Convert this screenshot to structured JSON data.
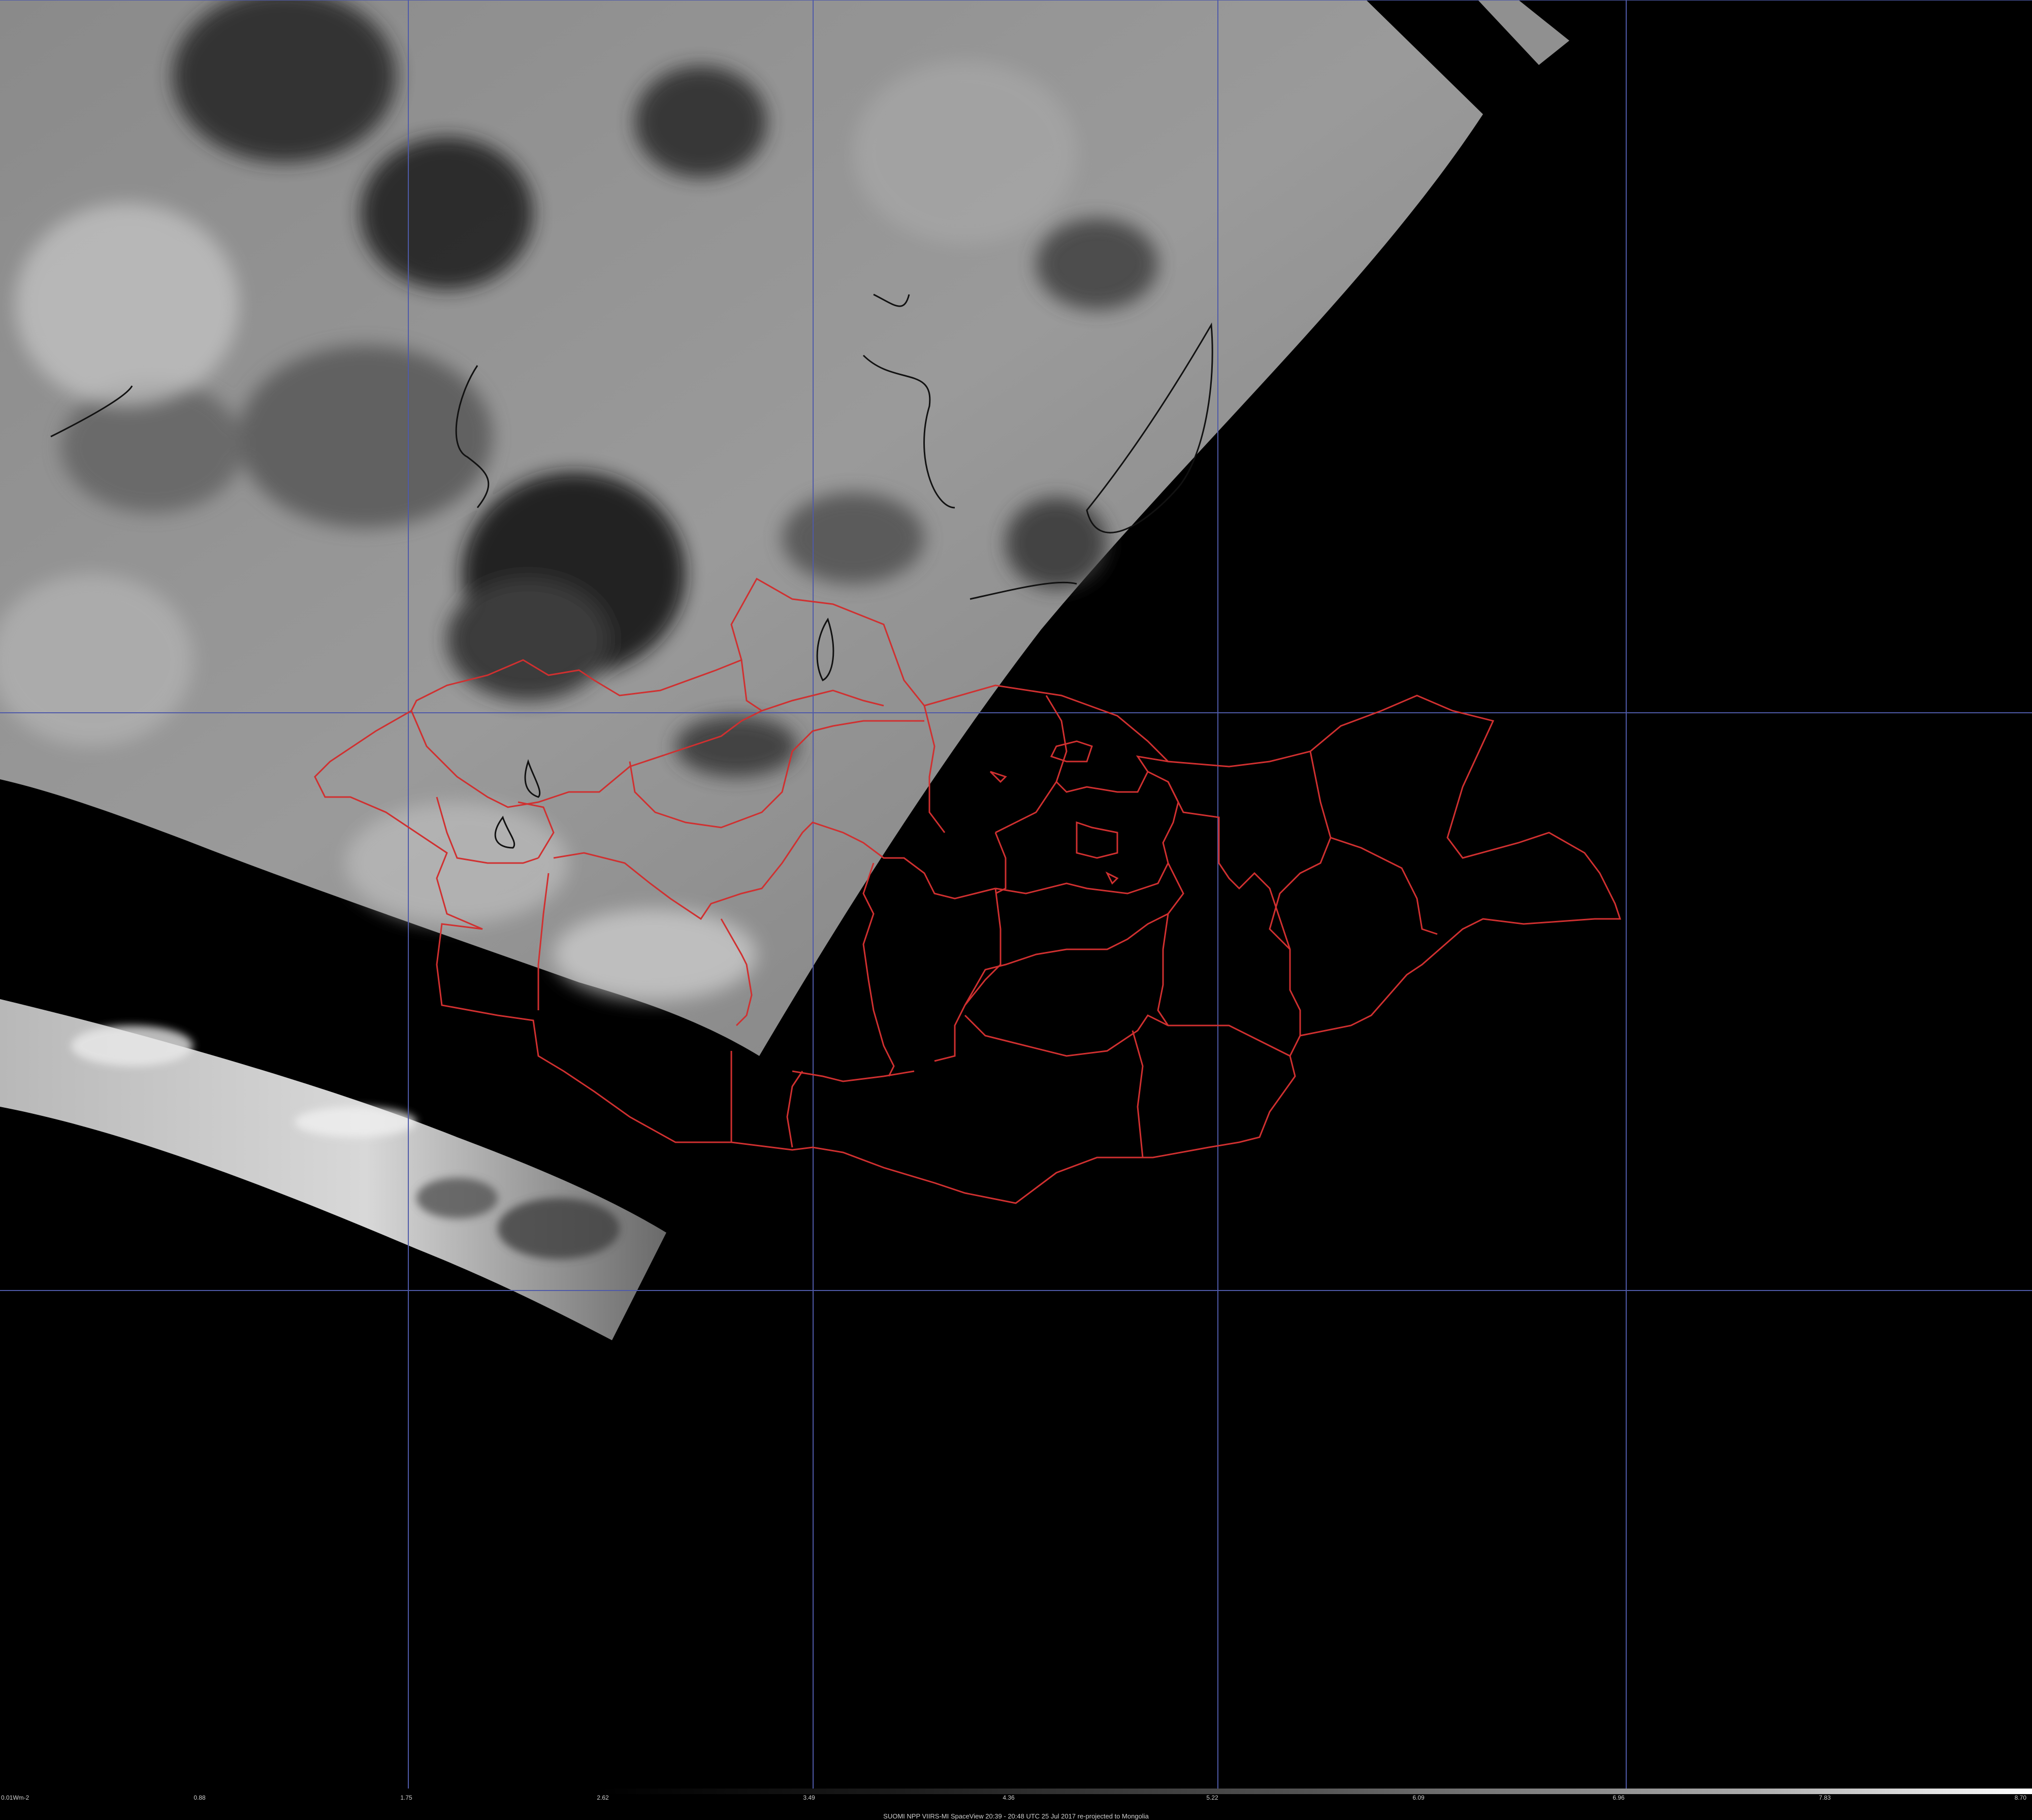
{
  "map": {
    "background": "#000000",
    "graticule_color": "#4f5aa8",
    "border_color": "#d03030",
    "water_outline_color": "#111111",
    "imagery": "grayscale satellite swaths (clouds dark, surface light)"
  },
  "colorbar": {
    "tick_labels": [
      "0.01Wm-2",
      "0.88",
      "1.75",
      "2.62",
      "3.49",
      "4.36",
      "5.22",
      "6.09",
      "6.96",
      "7.83",
      "8.70"
    ]
  },
  "caption": "SUOMI NPP VIIRS-MI SpaceView 20:39 - 20:48 UTC 25 Jul 2017 re-projected to Mongolia"
}
